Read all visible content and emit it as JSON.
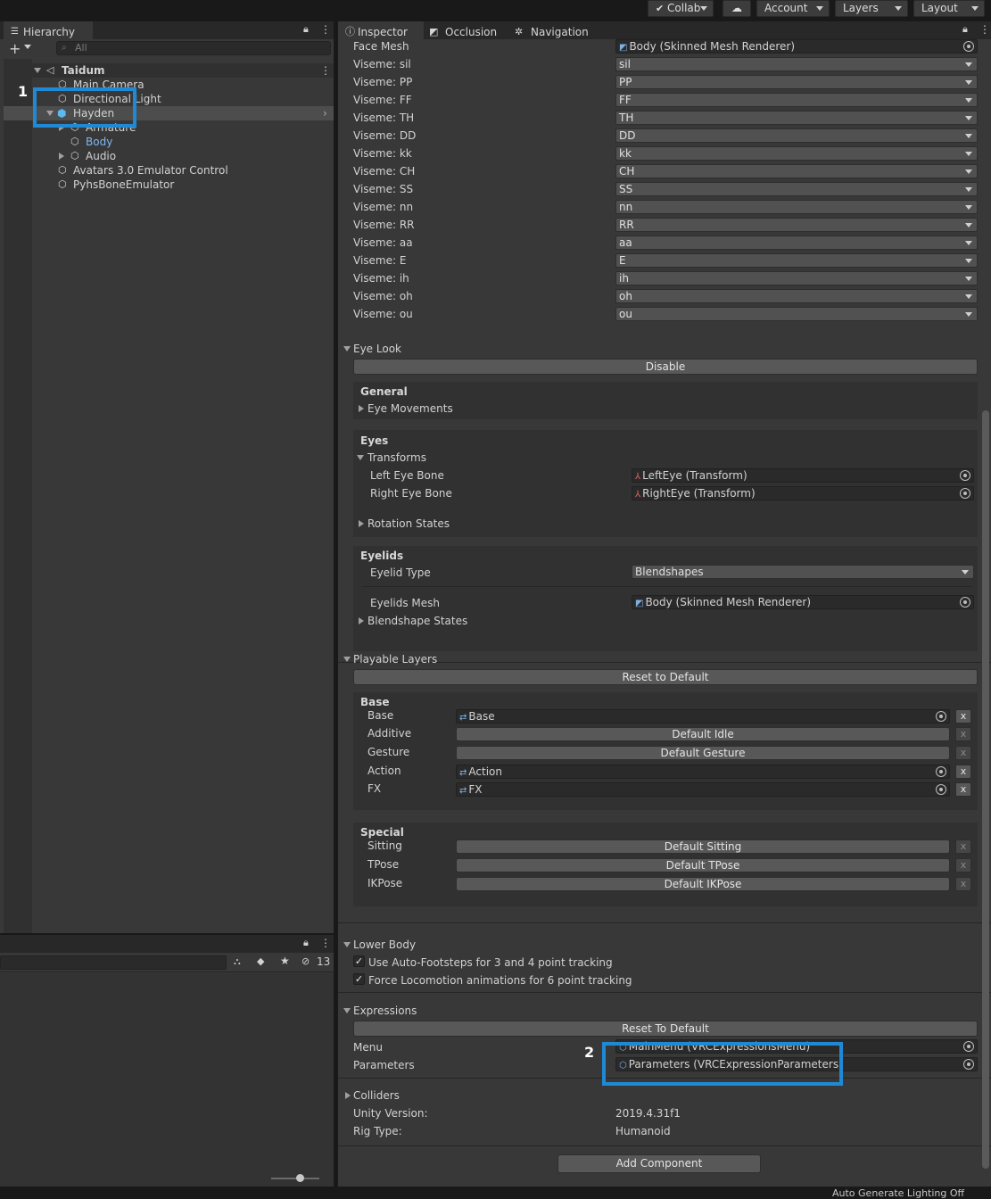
{
  "toolbar": {
    "collab": "Collab",
    "account": "Account",
    "layers": "Layers",
    "layout": "Layout"
  },
  "hierarchy": {
    "tab": "Hierarchy",
    "search_placeholder": "All",
    "items": [
      {
        "label": "Taidum",
        "bold": true
      },
      {
        "label": "Main Camera"
      },
      {
        "label": "Directional Light"
      },
      {
        "label": "Hayden"
      },
      {
        "label": "Armature"
      },
      {
        "label": "Body"
      },
      {
        "label": "Audio"
      },
      {
        "label": "Avatars 3.0 Emulator Control"
      },
      {
        "label": "PyhsBoneEmulator"
      }
    ]
  },
  "project": {
    "count": "13"
  },
  "inspector": {
    "tabs": [
      "Inspector",
      "Occlusion",
      "Navigation"
    ],
    "face_mesh": {
      "label": "Face Mesh",
      "value": "Body (Skinned Mesh Renderer)"
    },
    "visemes": [
      {
        "label": "Viseme: sil",
        "value": "sil"
      },
      {
        "label": "Viseme: PP",
        "value": "PP"
      },
      {
        "label": "Viseme: FF",
        "value": "FF"
      },
      {
        "label": "Viseme: TH",
        "value": "TH"
      },
      {
        "label": "Viseme: DD",
        "value": "DD"
      },
      {
        "label": "Viseme: kk",
        "value": "kk"
      },
      {
        "label": "Viseme: CH",
        "value": "CH"
      },
      {
        "label": "Viseme: SS",
        "value": "SS"
      },
      {
        "label": "Viseme: nn",
        "value": "nn"
      },
      {
        "label": "Viseme: RR",
        "value": "RR"
      },
      {
        "label": "Viseme: aa",
        "value": "aa"
      },
      {
        "label": "Viseme: E",
        "value": "E"
      },
      {
        "label": "Viseme: ih",
        "value": "ih"
      },
      {
        "label": "Viseme: oh",
        "value": "oh"
      },
      {
        "label": "Viseme: ou",
        "value": "ou"
      }
    ],
    "eye_look": {
      "title": "Eye Look",
      "disable": "Disable",
      "general": "General",
      "eye_movements": "Eye Movements",
      "eyes": "Eyes",
      "transforms": "Transforms",
      "left_eye_label": "Left Eye Bone",
      "left_eye_value": "LeftEye (Transform)",
      "right_eye_label": "Right Eye Bone",
      "right_eye_value": "RightEye (Transform)",
      "rotation_states": "Rotation States",
      "eyelids": "Eyelids",
      "eyelid_type_label": "Eyelid Type",
      "eyelid_type_value": "Blendshapes",
      "eyelids_mesh_label": "Eyelids Mesh",
      "eyelids_mesh_value": "Body (Skinned Mesh Renderer)",
      "blendshape_states": "Blendshape States"
    },
    "playable_layers": {
      "title": "Playable Layers",
      "reset": "Reset to Default",
      "base_header": "Base",
      "base_rows": [
        {
          "label": "Base",
          "value": "Base",
          "kind": "field"
        },
        {
          "label": "Additive",
          "value": "Default Idle",
          "kind": "button"
        },
        {
          "label": "Gesture",
          "value": "Default Gesture",
          "kind": "button"
        },
        {
          "label": "Action",
          "value": "Action",
          "kind": "field"
        },
        {
          "label": "FX",
          "value": "FX",
          "kind": "field"
        }
      ],
      "special_header": "Special",
      "special_rows": [
        {
          "label": "Sitting",
          "value": "Default Sitting"
        },
        {
          "label": "TPose",
          "value": "Default TPose"
        },
        {
          "label": "IKPose",
          "value": "Default IKPose"
        }
      ],
      "x": "x"
    },
    "lower_body": {
      "title": "Lower Body",
      "opt1": "Use Auto-Footsteps for 3 and 4 point tracking",
      "opt2": "Force Locomotion animations for 6 point tracking"
    },
    "expressions": {
      "title": "Expressions",
      "reset": "Reset To Default",
      "menu_label": "Menu",
      "menu_value": "MainMenu (VRCExpressionsMenu)",
      "params_label": "Parameters",
      "params_value": "Parameters (VRCExpressionParameters)"
    },
    "colliders": "Colliders",
    "unity_version_label": "Unity Version:",
    "unity_version_value": "2019.4.31f1",
    "rig_type_label": "Rig Type:",
    "rig_type_value": "Humanoid",
    "add_component": "Add Component"
  },
  "annotations": {
    "one": "1",
    "two": "2"
  },
  "status": "Auto Generate Lighting Off"
}
